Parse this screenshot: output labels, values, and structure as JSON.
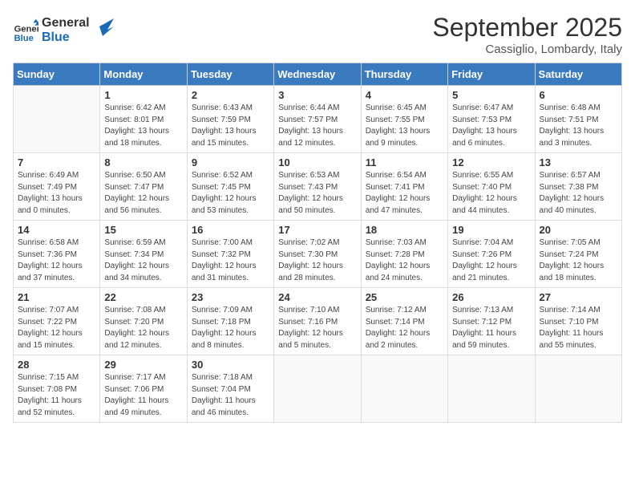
{
  "logo": {
    "general": "General",
    "blue": "Blue"
  },
  "header": {
    "month_year": "September 2025",
    "location": "Cassiglio, Lombardy, Italy"
  },
  "days_of_week": [
    "Sunday",
    "Monday",
    "Tuesday",
    "Wednesday",
    "Thursday",
    "Friday",
    "Saturday"
  ],
  "weeks": [
    [
      {
        "day": "",
        "info": ""
      },
      {
        "day": "1",
        "info": "Sunrise: 6:42 AM\nSunset: 8:01 PM\nDaylight: 13 hours\nand 18 minutes."
      },
      {
        "day": "2",
        "info": "Sunrise: 6:43 AM\nSunset: 7:59 PM\nDaylight: 13 hours\nand 15 minutes."
      },
      {
        "day": "3",
        "info": "Sunrise: 6:44 AM\nSunset: 7:57 PM\nDaylight: 13 hours\nand 12 minutes."
      },
      {
        "day": "4",
        "info": "Sunrise: 6:45 AM\nSunset: 7:55 PM\nDaylight: 13 hours\nand 9 minutes."
      },
      {
        "day": "5",
        "info": "Sunrise: 6:47 AM\nSunset: 7:53 PM\nDaylight: 13 hours\nand 6 minutes."
      },
      {
        "day": "6",
        "info": "Sunrise: 6:48 AM\nSunset: 7:51 PM\nDaylight: 13 hours\nand 3 minutes."
      }
    ],
    [
      {
        "day": "7",
        "info": "Sunrise: 6:49 AM\nSunset: 7:49 PM\nDaylight: 13 hours\nand 0 minutes."
      },
      {
        "day": "8",
        "info": "Sunrise: 6:50 AM\nSunset: 7:47 PM\nDaylight: 12 hours\nand 56 minutes."
      },
      {
        "day": "9",
        "info": "Sunrise: 6:52 AM\nSunset: 7:45 PM\nDaylight: 12 hours\nand 53 minutes."
      },
      {
        "day": "10",
        "info": "Sunrise: 6:53 AM\nSunset: 7:43 PM\nDaylight: 12 hours\nand 50 minutes."
      },
      {
        "day": "11",
        "info": "Sunrise: 6:54 AM\nSunset: 7:41 PM\nDaylight: 12 hours\nand 47 minutes."
      },
      {
        "day": "12",
        "info": "Sunrise: 6:55 AM\nSunset: 7:40 PM\nDaylight: 12 hours\nand 44 minutes."
      },
      {
        "day": "13",
        "info": "Sunrise: 6:57 AM\nSunset: 7:38 PM\nDaylight: 12 hours\nand 40 minutes."
      }
    ],
    [
      {
        "day": "14",
        "info": "Sunrise: 6:58 AM\nSunset: 7:36 PM\nDaylight: 12 hours\nand 37 minutes."
      },
      {
        "day": "15",
        "info": "Sunrise: 6:59 AM\nSunset: 7:34 PM\nDaylight: 12 hours\nand 34 minutes."
      },
      {
        "day": "16",
        "info": "Sunrise: 7:00 AM\nSunset: 7:32 PM\nDaylight: 12 hours\nand 31 minutes."
      },
      {
        "day": "17",
        "info": "Sunrise: 7:02 AM\nSunset: 7:30 PM\nDaylight: 12 hours\nand 28 minutes."
      },
      {
        "day": "18",
        "info": "Sunrise: 7:03 AM\nSunset: 7:28 PM\nDaylight: 12 hours\nand 24 minutes."
      },
      {
        "day": "19",
        "info": "Sunrise: 7:04 AM\nSunset: 7:26 PM\nDaylight: 12 hours\nand 21 minutes."
      },
      {
        "day": "20",
        "info": "Sunrise: 7:05 AM\nSunset: 7:24 PM\nDaylight: 12 hours\nand 18 minutes."
      }
    ],
    [
      {
        "day": "21",
        "info": "Sunrise: 7:07 AM\nSunset: 7:22 PM\nDaylight: 12 hours\nand 15 minutes."
      },
      {
        "day": "22",
        "info": "Sunrise: 7:08 AM\nSunset: 7:20 PM\nDaylight: 12 hours\nand 12 minutes."
      },
      {
        "day": "23",
        "info": "Sunrise: 7:09 AM\nSunset: 7:18 PM\nDaylight: 12 hours\nand 8 minutes."
      },
      {
        "day": "24",
        "info": "Sunrise: 7:10 AM\nSunset: 7:16 PM\nDaylight: 12 hours\nand 5 minutes."
      },
      {
        "day": "25",
        "info": "Sunrise: 7:12 AM\nSunset: 7:14 PM\nDaylight: 12 hours\nand 2 minutes."
      },
      {
        "day": "26",
        "info": "Sunrise: 7:13 AM\nSunset: 7:12 PM\nDaylight: 11 hours\nand 59 minutes."
      },
      {
        "day": "27",
        "info": "Sunrise: 7:14 AM\nSunset: 7:10 PM\nDaylight: 11 hours\nand 55 minutes."
      }
    ],
    [
      {
        "day": "28",
        "info": "Sunrise: 7:15 AM\nSunset: 7:08 PM\nDaylight: 11 hours\nand 52 minutes."
      },
      {
        "day": "29",
        "info": "Sunrise: 7:17 AM\nSunset: 7:06 PM\nDaylight: 11 hours\nand 49 minutes."
      },
      {
        "day": "30",
        "info": "Sunrise: 7:18 AM\nSunset: 7:04 PM\nDaylight: 11 hours\nand 46 minutes."
      },
      {
        "day": "",
        "info": ""
      },
      {
        "day": "",
        "info": ""
      },
      {
        "day": "",
        "info": ""
      },
      {
        "day": "",
        "info": ""
      }
    ]
  ]
}
